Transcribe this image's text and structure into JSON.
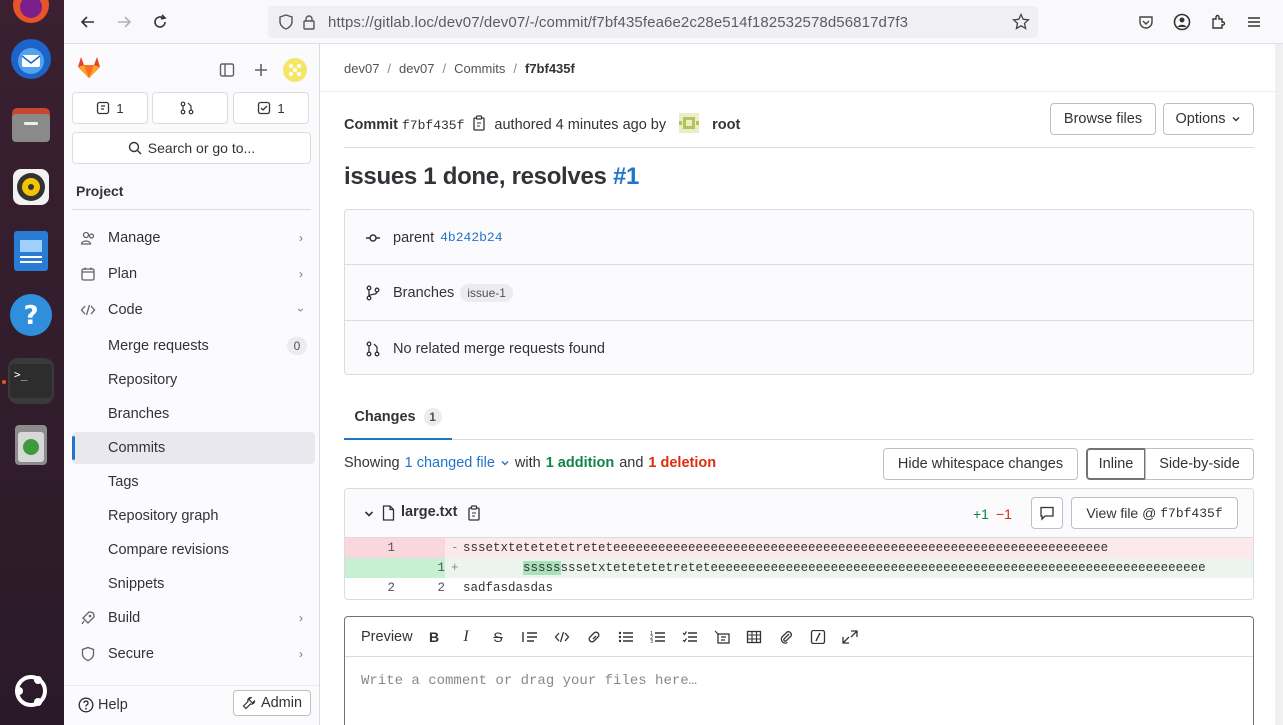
{
  "browser": {
    "url": "https://gitlab.loc/dev07/dev07/-/commit/f7bf435fea6e2c28e514f182532578d56817d7f3"
  },
  "sidebar": {
    "counters": {
      "issues": "1",
      "merge_requests": "",
      "todos": "1"
    },
    "search_label": "Search or go to...",
    "project_label": "Project",
    "nav": {
      "manage": "Manage",
      "plan": "Plan",
      "code": "Code",
      "merge_requests": "Merge requests",
      "merge_requests_count": "0",
      "repository": "Repository",
      "branches": "Branches",
      "commits": "Commits",
      "tags": "Tags",
      "repository_graph": "Repository graph",
      "compare_revisions": "Compare revisions",
      "snippets": "Snippets",
      "build": "Build",
      "secure": "Secure"
    },
    "help_label": "Help",
    "admin_label": "Admin"
  },
  "breadcrumb": [
    "dev07",
    "dev07",
    "Commits",
    "f7bf435f"
  ],
  "commit": {
    "label": "Commit",
    "short_sha": "f7bf435f",
    "authored_text": "authored 4 minutes ago by",
    "author": "root",
    "browse_files": "Browse files",
    "options": "Options",
    "title_text": "issues 1 done, resolves",
    "title_ref": "#1",
    "parent_label": "parent",
    "parent_sha": "4b242b24",
    "branches_label": "Branches",
    "branch_name": "issue-1",
    "mr_text": "No related merge requests found"
  },
  "changes": {
    "tab_label": "Changes",
    "tab_count": "1",
    "showing": "Showing",
    "changed_files": "1 changed file",
    "with": "with",
    "additions": "1 addition",
    "and": "and",
    "deletions": "1 deletion",
    "hide_whitespace": "Hide whitespace changes",
    "inline": "Inline",
    "side_by_side": "Side-by-side"
  },
  "file": {
    "name": "large.txt",
    "added": "+1",
    "removed": "−1",
    "view_file": "View file @ ",
    "view_file_sha": "f7bf435f",
    "lines": [
      {
        "old": "1",
        "new": "",
        "sign": "-",
        "text": "sssetxtetetetetreteteeeeeeeeeeeeeeeeeeeeeeeeeeeeeeeeeeeeeeeeeeeeeeeeeeeeeeeeeeeeeeeeee"
      },
      {
        "old": "",
        "new": "1",
        "sign": "+",
        "hl": "sssss",
        "text": "sssetxtetetetetreteteeeeeeeeeeeeeeeeeeeeeeeeeeeeeeeeeeeeeeeeeeeeeeeeeeeeeeeeeeeeeeeeee"
      },
      {
        "old": "2",
        "new": "2",
        "sign": "",
        "text": "sadfasdasdas"
      }
    ]
  },
  "comment": {
    "preview_label": "Preview",
    "placeholder": "Write a comment or drag your files here…"
  }
}
